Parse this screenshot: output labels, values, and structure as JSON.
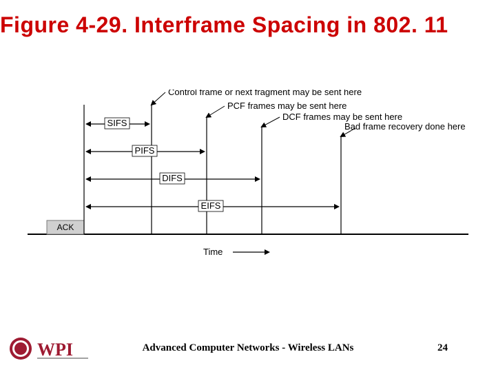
{
  "title": "Figure 4-29. Interframe Spacing in 802. 11",
  "diagram": {
    "ack_label": "ACK",
    "time_label": "Time",
    "intervals": {
      "sifs": "SIFS",
      "pifs": "PIFS",
      "difs": "DIFS",
      "eifs": "EIFS"
    },
    "annotations": {
      "control_frame": "Control frame or next fragment may be sent here",
      "pcf_frames": "PCF frames may be sent here",
      "dcf_frames": "DCF frames may be sent here",
      "bad_frame": "Bad frame recovery done here"
    }
  },
  "footer": "Advanced Computer Networks - Wireless LANs",
  "page_number": "24",
  "logo": {
    "text": "WPI",
    "color": "#9e1b32"
  }
}
